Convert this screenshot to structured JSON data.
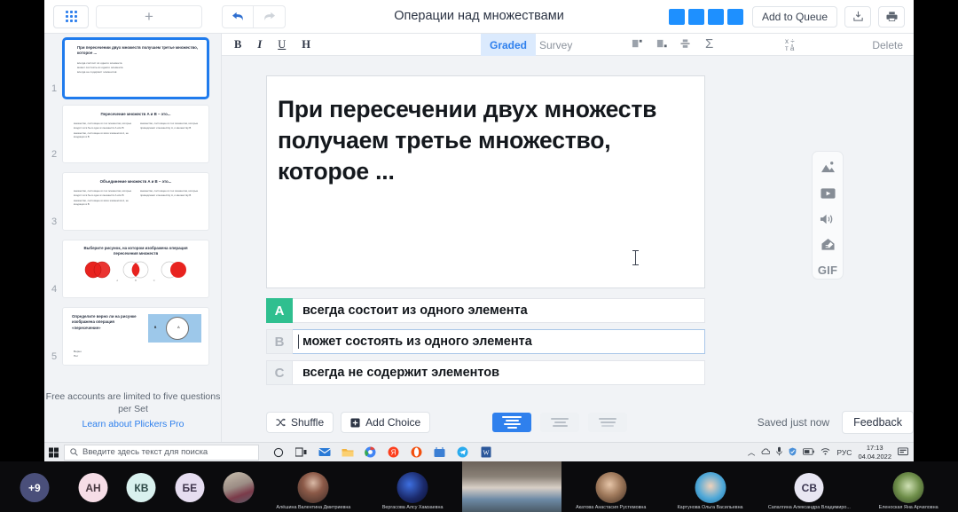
{
  "app": {
    "doc_title": "Операции над множествами",
    "topbar": {
      "grid_icon": "apps-grid-icon",
      "new_label": "+",
      "undo_icon": "undo-arrow-icon",
      "redo_icon": "redo-arrow-icon",
      "add_to_queue": "Add to Queue",
      "download_icon": "download-icon",
      "print_icon": "print-icon"
    },
    "format_bar": {
      "bold": "B",
      "italic": "I",
      "underline": "U",
      "heading": "H",
      "tab_graded": "Graded",
      "tab_survey": "Survey",
      "sigma": "Σ",
      "delete": "Delete"
    }
  },
  "sidebar": {
    "slides": [
      {
        "number": "1",
        "title": "При пересечении двух множеств получаем третье множество, которое ...",
        "options": [
          "всегда состоит из одного элемента",
          "может состоять из одного элемента",
          "всегда не содержит элементов"
        ],
        "selected": true
      },
      {
        "number": "2",
        "title": "Пересечение множеств A и B – это...",
        "options_left": [
          "множество, состоящее из тех элементов, которые входят хотя бы в одно из множеств A или B",
          "множество, состоящее из всех элементов A, не входящих в B"
        ],
        "options_right": [
          "множество, состоящее из тех элементов, которые принадлежат и множеству A, и множеству B"
        ],
        "selected": false
      },
      {
        "number": "3",
        "title": "Объединение множеств A и B – это...",
        "options_left": [
          "множество, состоящее из тех элементов, которые входят хотя бы в одно из множеств A или B",
          "множество, состоящее из всех элементов A, не входящих в B"
        ],
        "options_right": [
          "множество, состоящее из тех элементов, которые принадлежат и множеству A, и множеству B"
        ],
        "selected": false
      },
      {
        "number": "4",
        "title": "Выберите рисунок, на котором изображена операция пересечения множеств",
        "image_labels": [
          "A",
          "B",
          "C"
        ],
        "selected": false
      },
      {
        "number": "5",
        "title": "Определите верно ли на рисунке изображена операция «пересечение»",
        "options": [
          "Верно",
          "Нет"
        ],
        "diagram_labels": [
          "B",
          "A"
        ],
        "selected": false
      }
    ],
    "footer_note": "Free accounts are limited to five questions per Set",
    "footer_link": "Learn about Plickers Pro"
  },
  "editor": {
    "question_text": "При пересечении двух множеств получаем третье множество, которое ...",
    "choices": [
      {
        "letter": "A",
        "text": "всегда состоит из одного элемента",
        "correct": true,
        "active": false
      },
      {
        "letter": "B",
        "text": "может состоять из одного элемента",
        "correct": false,
        "active": true
      },
      {
        "letter": "C",
        "text": "всегда не содержит элементов",
        "correct": false,
        "active": false
      }
    ],
    "shuffle_label": "Shuffle",
    "shuffle_icon": "shuffle-icon",
    "add_choice_label": "Add Choice",
    "add_choice_icon": "plus-square-icon",
    "align_buttons": [
      "align-left-icon",
      "align-center-icon",
      "align-compact-icon"
    ],
    "align_selected_index": 0,
    "saved_status": "Saved just now",
    "feedback_label": "Feedback"
  },
  "media_toolbar": {
    "items": [
      {
        "icon": "image-icon",
        "label": ""
      },
      {
        "icon": "video-icon",
        "label": ""
      },
      {
        "icon": "audio-icon",
        "label": ""
      },
      {
        "icon": "draw-icon",
        "label": ""
      },
      {
        "icon": "gif-icon",
        "label": "GIF"
      }
    ]
  },
  "taskbar": {
    "start_icon": "windows-start-icon",
    "search_icon": "search-icon",
    "search_placeholder": "Введите здесь текст для поиска",
    "pinned_icons": [
      "cortana-circle-icon",
      "task-view-icon",
      "mail-icon",
      "explorer-icon",
      "chrome-icon",
      "yandex-icon",
      "opera-icon",
      "store-icon",
      "telegram-icon",
      "word-icon"
    ],
    "tray_icons": [
      "chevron-up-icon",
      "onedrive-icon",
      "mic-icon",
      "security-icon",
      "battery-icon",
      "network-icon"
    ],
    "language": "РУС",
    "time": "17:13",
    "date": "04.04.2022",
    "notification_icon": "notification-icon"
  },
  "video_strip": {
    "overflow_badge": "+9",
    "participants": [
      {
        "initials": "+9",
        "name": "",
        "color": "#4a4f7a",
        "text_color": "#ffffff",
        "kind": "badge"
      },
      {
        "initials": "АН",
        "name": "",
        "color": "#f6dde6",
        "text_color": "#4a3a42",
        "kind": "initials"
      },
      {
        "initials": "КВ",
        "name": "",
        "color": "#d9f1ee",
        "text_color": "#2e4a47",
        "kind": "initials"
      },
      {
        "initials": "БЕ",
        "name": "",
        "color": "#e6ddf0",
        "text_color": "#40364d",
        "kind": "initials"
      },
      {
        "initials": "",
        "name": "",
        "color": "#8a7f78",
        "text_color": "#ffffff",
        "kind": "photo"
      },
      {
        "initials": "",
        "name": "Алёшина Валентина Дмитриевна",
        "color": "#6b5a55",
        "text_color": "#ffffff",
        "kind": "photo"
      },
      {
        "initials": "",
        "name": "Вергасова Алсу Хамзаевна",
        "color": "#1b2a6b",
        "text_color": "#ffffff",
        "kind": "photo"
      },
      {
        "initials": "",
        "name": "",
        "color": "#6f7d8c",
        "text_color": "#ffffff",
        "kind": "video"
      },
      {
        "initials": "",
        "name": "Акатова Анастасия Рустемовна",
        "color": "#9a8475",
        "text_color": "#ffffff",
        "kind": "photo"
      },
      {
        "initials": "",
        "name": "Картунова Ольга Васильевна",
        "color": "#3ba7d6",
        "text_color": "#ffffff",
        "kind": "photo"
      },
      {
        "initials": "СВ",
        "name": "Сапалгина Александра Владимиро...",
        "color": "#e8e6f2",
        "text_color": "#3a3550",
        "kind": "initials"
      },
      {
        "initials": "",
        "name": "Еленоская Яна Арчиловна",
        "color": "#5f7a4a",
        "text_color": "#ffffff",
        "kind": "photo"
      }
    ]
  },
  "colors": {
    "accent_blue": "#2f80ed",
    "correct_green": "#2fbf8f",
    "app_bg": "#f1f3f6",
    "panel_white": "#ffffff"
  }
}
